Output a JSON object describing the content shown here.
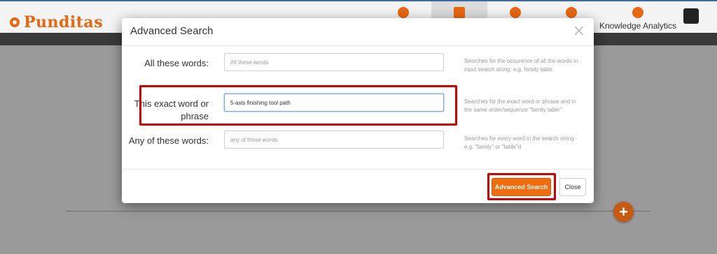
{
  "app": {
    "logo_text": "Punditas",
    "nav": [
      {
        "icon": "dashboard-icon",
        "label": ""
      },
      {
        "icon": "network-icon",
        "label": ""
      },
      {
        "icon": "lightbulb-icon",
        "label": ""
      },
      {
        "icon": "target-icon",
        "label": ""
      },
      {
        "icon": "brain-icon",
        "label": "Knowledge Analytics"
      }
    ],
    "accent_color": "#f26b0c"
  },
  "modal": {
    "title": "Advanced Search",
    "close_glyph": "×",
    "rows": [
      {
        "label": "All these words:",
        "value": "",
        "placeholder": "All these words",
        "help": "Searches for the occurence of all the words in input search string: e.g. family table"
      },
      {
        "label": "This exact word or phrase",
        "value": "5-axis finishing tool path",
        "placeholder": "",
        "help": "Searches for the exact word or phrase and in the same order/sequence \"family table\""
      },
      {
        "label": "Any of these words:",
        "value": "",
        "placeholder": "any of these words",
        "help": "Searches for every word in the search string - e.g. \"family\" or \"table\"d"
      }
    ],
    "search_button": "Advanced Search",
    "close_button": "Close"
  },
  "fab_label": "+"
}
